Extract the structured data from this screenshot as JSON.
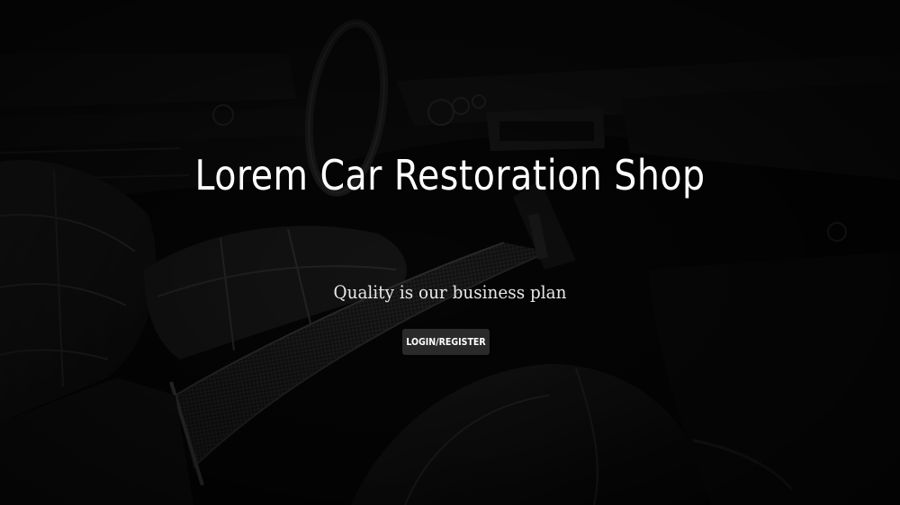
{
  "hero": {
    "title": "Lorem Car Restoration Shop",
    "tagline": "Quality is our business plan",
    "cta_label": "LOGIN/REGISTER"
  },
  "colors": {
    "background": "#050505",
    "text": "#ffffff",
    "button": "#2a2a2a"
  }
}
